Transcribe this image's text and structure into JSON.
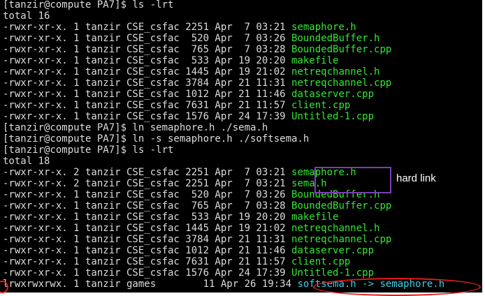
{
  "terminal": {
    "lines": [
      {
        "text": "[tanzir@compute PA7]$ ls -lrt",
        "file": ""
      },
      {
        "text": "total 16",
        "file": ""
      },
      {
        "text": "-rwxr-xr-x. 1 tanzir CSE_csfac 2251 Apr  7 03:21 ",
        "file": "semaphore.h"
      },
      {
        "text": "-rwxr-xr-x. 1 tanzir CSE_csfac  520 Apr  7 03:26 ",
        "file": "BoundedBuffer.h"
      },
      {
        "text": "-rwxr-xr-x. 1 tanzir CSE_csfac  765 Apr  7 03:28 ",
        "file": "BoundedBuffer.cpp"
      },
      {
        "text": "-rwxr-xr-x. 1 tanzir CSE_csfac  533 Apr 19 20:20 ",
        "file": "makefile"
      },
      {
        "text": "-rwxr-xr-x. 1 tanzir CSE_csfac 1445 Apr 19 21:02 ",
        "file": "netreqchannel.h"
      },
      {
        "text": "-rwxr-xr-x. 1 tanzir CSE_csfac 3784 Apr 21 11:31 ",
        "file": "netreqchannel.cpp"
      },
      {
        "text": "-rwxr-xr-x. 1 tanzir CSE_csfac 1012 Apr 21 11:46 ",
        "file": "dataserver.cpp"
      },
      {
        "text": "-rwxr-xr-x. 1 tanzir CSE_csfac 7631 Apr 21 11:57 ",
        "file": "client.cpp"
      },
      {
        "text": "-rwxr-xr-x. 1 tanzir CSE_csfac 1576 Apr 24 17:39 ",
        "file": "Untitled-1.cpp"
      },
      {
        "text": "[tanzir@compute PA7]$ ln semaphore.h ./sema.h",
        "file": ""
      },
      {
        "text": "[tanzir@compute PA7]$ ln -s semaphore.h ./softsema.h",
        "file": ""
      },
      {
        "text": "[tanzir@compute PA7]$ ls -lrt",
        "file": ""
      },
      {
        "text": "total 18",
        "file": ""
      },
      {
        "text": "-rwxr-xr-x. 2 tanzir CSE_csfac 2251 Apr  7 03:21 ",
        "file": "semaphore.h"
      },
      {
        "text": "-rwxr-xr-x. 2 tanzir CSE_csfac 2251 Apr  7 03:21 ",
        "file": "sema.h"
      },
      {
        "text": "-rwxr-xr-x. 1 tanzir CSE_csfac  520 Apr  7 03:26 ",
        "file": "BoundedBuffer.h"
      },
      {
        "text": "-rwxr-xr-x. 1 tanzir CSE_csfac  765 Apr  7 03:28 ",
        "file": "BoundedBuffer.cpp"
      },
      {
        "text": "-rwxr-xr-x. 1 tanzir CSE_csfac  533 Apr 19 20:20 ",
        "file": "makefile"
      },
      {
        "text": "-rwxr-xr-x. 1 tanzir CSE_csfac 1445 Apr 19 21:02 ",
        "file": "netreqchannel.h"
      },
      {
        "text": "-rwxr-xr-x. 1 tanzir CSE_csfac 3784 Apr 21 11:31 ",
        "file": "netreqchannel.cpp"
      },
      {
        "text": "-rwxr-xr-x. 1 tanzir CSE_csfac 1012 Apr 21 11:46 ",
        "file": "dataserver.cpp"
      },
      {
        "text": "-rwxr-xr-x. 1 tanzir CSE_csfac 7631 Apr 21 11:57 ",
        "file": "client.cpp"
      },
      {
        "text": "-rwxr-xr-x. 1 tanzir CSE_csfac 1576 Apr 24 17:39 ",
        "file": "Untitled-1.cpp"
      }
    ],
    "symlink_line": {
      "prefix": "lrwxrwxrwx. 1 tanzir games        11 Apr 26 19:34 ",
      "link_name": "softsema.h",
      "arrow": " -> ",
      "target": "semaphore.h"
    }
  },
  "annotations": {
    "hard_link_label": "hard link",
    "hard_link_box_color": "#7a3fb6",
    "symlink_highlight_color": "#e21b1b"
  },
  "colors": {
    "background": "#000000",
    "text": "#dcdcdc",
    "filename": "#33e633",
    "symlink": "#3bd0e6"
  }
}
